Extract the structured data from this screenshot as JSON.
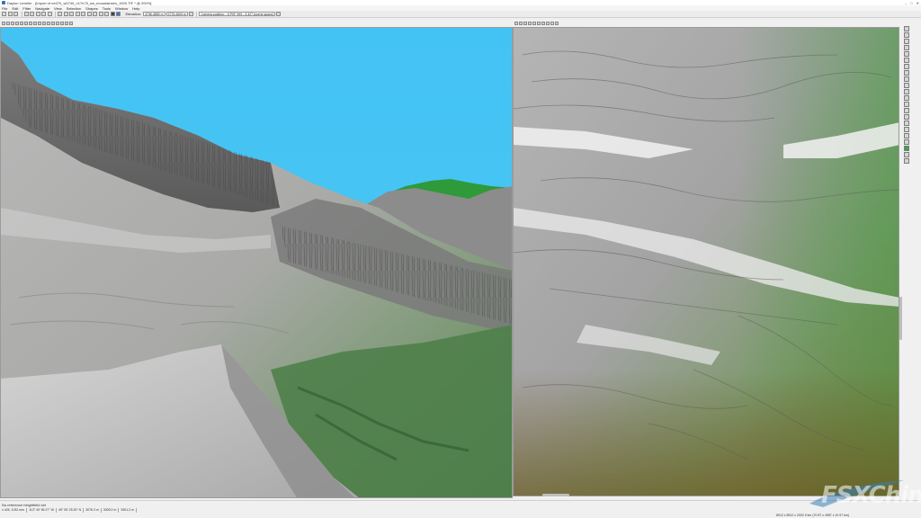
{
  "window": {
    "title": "Daylon Leveller - [Import of ne070_w0740_n17n75_sw_mountainsim_1000.TIF * @ 200%]"
  },
  "menu": {
    "items": [
      "File",
      "Edit",
      "Filter",
      "Navigate",
      "View",
      "Selection",
      "Shapes",
      "Tools",
      "Window",
      "Help"
    ]
  },
  "toolbar": {
    "elevation_label": "Elevation:",
    "elevation_min": "3796.4859 m",
    "elevation_max": "3775.4509 m",
    "camera_label": "Camera position: - 5 P0F 999 - 3.327 (scene space)"
  },
  "status": {
    "top_text": "No reference heightfield set",
    "cells": [
      "x 426, 1032 mm",
      "113° 49' 55.27\" W",
      "46° 05' 25.30\" N",
      "3076.3 m",
      "3005.0 m",
      "3901,3 m"
    ],
    "right_text": "8912 x 8512 x 2002 9 km (70 87 x 4987 x 10 97 km)"
  },
  "watermark": {
    "text": "FSXChina"
  },
  "colors": {
    "sky": "#43c3f4",
    "terrain_gray": "#9a9a9a",
    "terrain_green": "#5f8f5a",
    "terrain_brown": "#7d6a2a"
  }
}
